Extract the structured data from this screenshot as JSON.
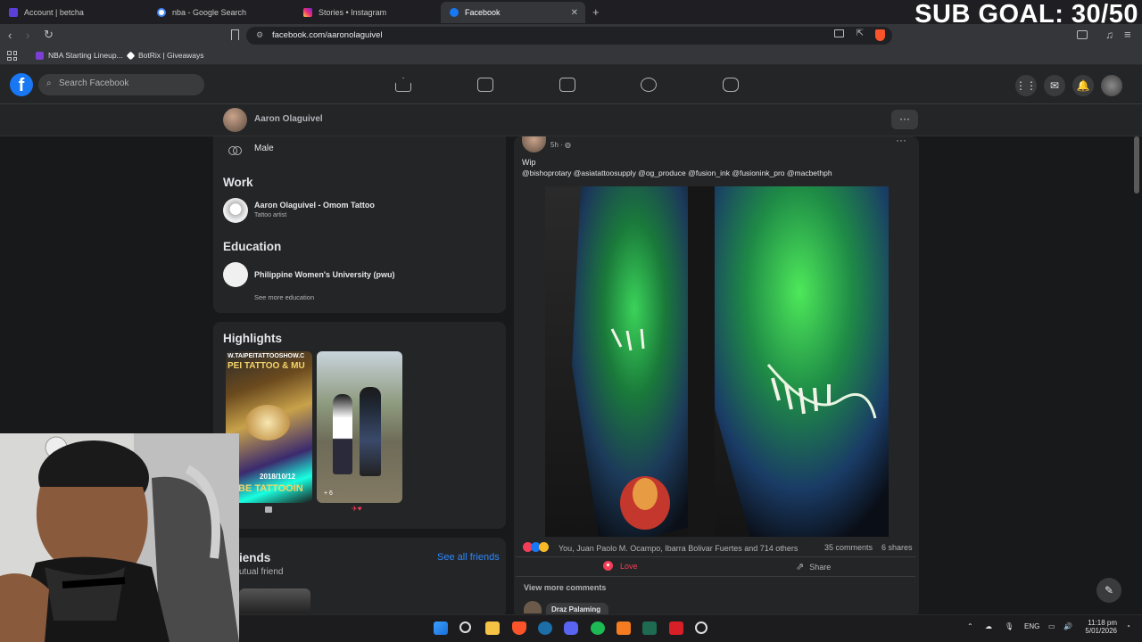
{
  "overlay": {
    "sub_goal": "SUB GOAL: 30/50"
  },
  "browser": {
    "tabs": [
      {
        "title": "Account | betcha",
        "color": "#5b3fd6"
      },
      {
        "title": "nba - Google Search",
        "color": "#4285f4"
      },
      {
        "title": "Stories • Instagram",
        "color": "#e1306c"
      },
      {
        "title": "Facebook",
        "color": "#1877f2"
      }
    ],
    "new_tab": "+",
    "url": "facebook.com/aaronolaguivel",
    "bookmarks": [
      {
        "label": "NBA Starting Lineup...",
        "color": "#7b3fd6"
      },
      {
        "label": "BotRix | Giveaways",
        "color": "#ffffff"
      }
    ]
  },
  "facebook": {
    "logo": "f",
    "search_placeholder": "Search Facebook",
    "profile_name": "Aaron Olaguivel",
    "more": "···",
    "about": {
      "gender": "Male",
      "work_title": "Work",
      "work_main": "Aaron Olaguivel - Omom Tattoo",
      "work_sub": "Tattoo artist",
      "education_title": "Education",
      "education_main": "Philippine Women's University (pwu)",
      "see_more_education": "See more education"
    },
    "highlights": {
      "title": "Highlights",
      "item1_text": "W.TAIPEITATTOOSHOW.C",
      "item1_text2": "PEI TATTOO & MU",
      "item1_date": "2018/10/12",
      "item1_bottom": "BE TATTOOIN",
      "item2_count": "+ 6"
    },
    "friends": {
      "title": "Friends",
      "title_visible": "iends",
      "mutual": "utual friend",
      "see_all": "See all friends"
    },
    "post": {
      "time": "5h · ",
      "caption": "Wip",
      "tags": "@bishoprotary  @asiatattoosupply  @og_produce  @fusion_ink @fusionink_pro @macbethph",
      "reactions": "You, Juan Paolo M. Ocampo, Ibarra Bolivar Fuertes and 714 others",
      "comments": "35 comments",
      "shares": "6 shares",
      "love": "Love",
      "share": "Share",
      "view_more": "View more comments",
      "commenter": "Draz Palaming"
    }
  },
  "tray": {
    "lang": "ENG",
    "time": "11:18 pm",
    "date": "5/01/2026"
  },
  "colors": {
    "fb_blue": "#1877f2",
    "link": "#2d88ff",
    "love": "#f33e58"
  }
}
